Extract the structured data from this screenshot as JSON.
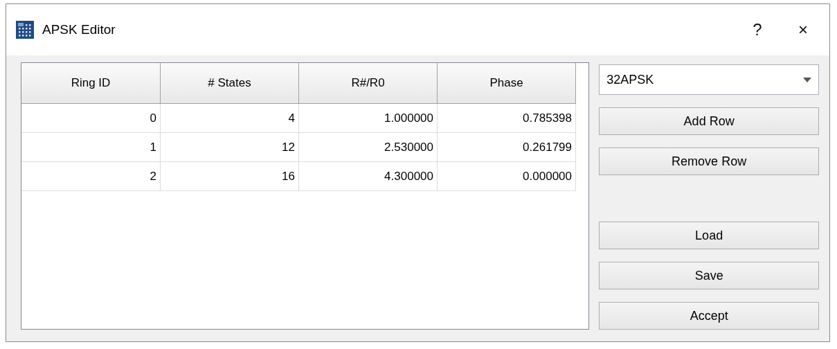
{
  "window": {
    "title": "APSK Editor",
    "help": "?",
    "close": "×"
  },
  "table": {
    "columns": [
      "Ring ID",
      "# States",
      "R#/R0",
      "Phase"
    ],
    "rows": [
      [
        "0",
        "4",
        "1.000000",
        "0.785398"
      ],
      [
        "1",
        "12",
        "2.530000",
        "0.261799"
      ],
      [
        "2",
        "16",
        "4.300000",
        "0.000000"
      ]
    ]
  },
  "preset": {
    "value": "32APSK"
  },
  "row_buttons": [
    "Add Row",
    "Remove Row"
  ],
  "file_buttons": [
    "Load",
    "Save",
    "Accept"
  ]
}
